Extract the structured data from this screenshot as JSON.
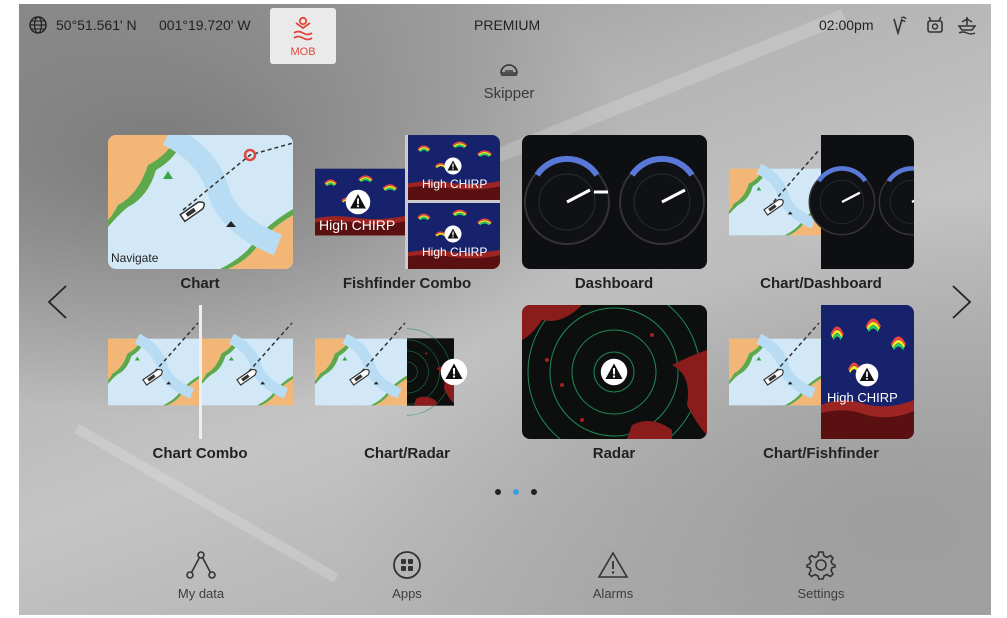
{
  "topbar": {
    "latitude": "50°51.561' N",
    "longitude": "001°19.720' W",
    "mob_label": "MOB",
    "title": "PREMIUM",
    "time": "02:00pm"
  },
  "skipper": {
    "label": "Skipper"
  },
  "apps": [
    {
      "label": "Chart",
      "overlay": "Navigate"
    },
    {
      "label": "Fishfinder Combo",
      "overlay_main": "High CHIRP",
      "overlay_top": "High CHIRP",
      "overlay_bottom": "High CHIRP"
    },
    {
      "label": "Dashboard"
    },
    {
      "label": "Chart/Dashboard"
    },
    {
      "label": "Chart Combo"
    },
    {
      "label": "Chart/Radar"
    },
    {
      "label": "Radar"
    },
    {
      "label": "Chart/Fishfinder",
      "overlay": "High CHIRP"
    }
  ],
  "pagination": {
    "pages": 3,
    "current": 2
  },
  "bottom_nav": [
    {
      "label": "My data",
      "icon": "share-nodes-icon"
    },
    {
      "label": "Apps",
      "icon": "apps-grid-icon"
    },
    {
      "label": "Alarms",
      "icon": "warning-triangle-icon"
    },
    {
      "label": "Settings",
      "icon": "gear-icon"
    }
  ],
  "colors": {
    "mob_red": "#e0473c",
    "accent_blue": "#3aa0df",
    "chart_water": "#d6ebf9",
    "chart_land": "#f2b677",
    "sonar_blue": "#16226b"
  }
}
